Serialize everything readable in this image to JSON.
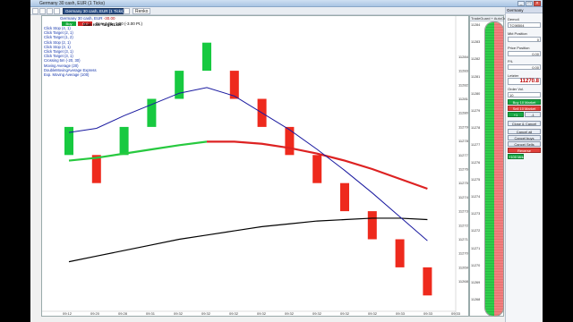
{
  "window": {
    "title": "Germany 30 cash, EUR (1 Ticks)",
    "controls": [
      "_",
      "□",
      "×"
    ]
  },
  "toolbar": {
    "instrument_label": "Germany 30 cash, EUR (1 Ticks)",
    "range_label": "Renko"
  },
  "header": {
    "instrument": "Germany 30 cash, EUR",
    "pnl": "-30.00",
    "pos_label": "Pos: 0  PL: 0.00 (-3.00 Pt.)",
    "buy_label": "Buy",
    "sell_label": "Sell"
  },
  "legend": {
    "title": "Main row: Target1.xls",
    "items": [
      "Click Stop (4, 1)",
      "Click Target (2, 1)",
      "Click Target (1, 2)",
      "Click Stop (2, 1)",
      "Click Stop (3, 1)",
      "Click Target (3, 1)",
      "Click Target (3, 1)",
      "Crossing 5m (-20, 30)",
      "Moving Average (20)",
      "DoubleMovingAverage Express",
      "Exp. Moving Average (100)"
    ]
  },
  "chart_data": {
    "type": "renko",
    "y_axis": [
      "11284",
      "11283",
      "11282",
      "11281",
      "11280",
      "11279",
      "11278",
      "11277",
      "11276",
      "11275",
      "11274",
      "11273",
      "11272",
      "11271",
      "11270",
      "11269",
      "11268"
    ],
    "x_axis": [
      "09:12",
      "09:20",
      "09:28",
      "09:31",
      "09:32",
      "09:32",
      "09:32",
      "09:32",
      "09:32",
      "09:32",
      "09:32",
      "09:32",
      "09:33",
      "09:33",
      "09:33"
    ],
    "bricks": [
      {
        "direction": "up",
        "high": 11279,
        "low": 11277
      },
      {
        "direction": "down",
        "high": 11277,
        "low": 11275
      },
      {
        "direction": "up",
        "high": 11279,
        "low": 11277
      },
      {
        "direction": "up",
        "high": 11281,
        "low": 11279
      },
      {
        "direction": "up",
        "high": 11283,
        "low": 11281
      },
      {
        "direction": "up",
        "high": 11285,
        "low": 11283
      },
      {
        "direction": "down",
        "high": 11283,
        "low": 11281
      },
      {
        "direction": "down",
        "high": 11281,
        "low": 11279
      },
      {
        "direction": "down",
        "high": 11279,
        "low": 11277
      },
      {
        "direction": "down",
        "high": 11277,
        "low": 11275
      },
      {
        "direction": "down",
        "high": 11275,
        "low": 11273
      },
      {
        "direction": "down",
        "high": 11273,
        "low": 11271
      },
      {
        "direction": "down",
        "high": 11271,
        "low": 11269
      },
      {
        "direction": "down",
        "high": 11269,
        "low": 11267
      }
    ],
    "series": [
      {
        "color": "#1a1aa0",
        "values": [
          11278.6,
          11278.9,
          11279.8,
          11280.6,
          11281.4,
          11281.8,
          11281.2,
          11280.0,
          11278.8,
          11277.4,
          11275.9,
          11274.3,
          11272.6,
          11270.9
        ]
      },
      {
        "color_up": "#27c93f",
        "color_down": "#dd2222",
        "values": [
          11276.6,
          11276.8,
          11277.1,
          11277.4,
          11277.7,
          11277.95,
          11277.95,
          11277.8,
          11277.5,
          11277.1,
          11276.6,
          11276.0,
          11275.3,
          11274.6
        ]
      },
      {
        "color": "#000000",
        "values": [
          11269.4,
          11269.8,
          11270.2,
          11270.6,
          11271.0,
          11271.3,
          11271.6,
          11271.9,
          11272.1,
          11272.3,
          11272.4,
          11272.5,
          11272.5,
          11272.4
        ]
      }
    ]
  },
  "dom": {
    "title": "TradeGuard + AutoOrder",
    "close": "Exit",
    "prices": [
      "11284",
      "11283",
      "11282",
      "11281",
      "11280",
      "11279",
      "11278",
      "11277",
      "11276",
      "11275",
      "11274",
      "11273",
      "11272",
      "11271",
      "11270",
      "11269",
      "11268"
    ],
    "buy_color": "#27b943",
    "sell_color": "#e77070"
  },
  "side": {
    "tab": "Germany",
    "account_label": "Demo4",
    "account_value": "TC98504",
    "position_label": "Mkt Position",
    "position_value": "0",
    "price_label": "Price Position",
    "price_value": "0.00",
    "pl_label": "P/L",
    "pl_value": "0.00",
    "last_label": "Letzter",
    "last_value": "11270.8",
    "order_label": "Order Vol.",
    "order_value": "10",
    "buy_btn": "Buy 10 Market",
    "sell_btn": "Sell 10 Market",
    "plus_btn": "+1",
    "minus_btn": "-1",
    "close_btn": "Close & Cancel",
    "cancel_all": "Cancel all",
    "cancel_buys": "Cancel buys",
    "cancel_sells": "Cancel Sells",
    "reverse": "Reverse",
    "ok_btn": "+100 Mrk"
  }
}
